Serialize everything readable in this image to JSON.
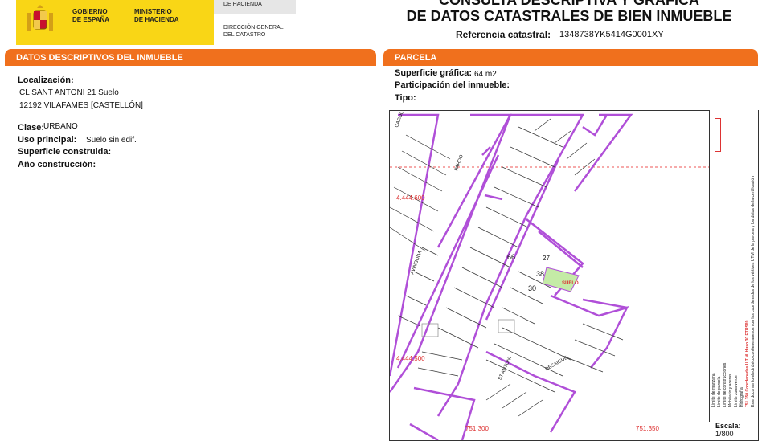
{
  "header": {
    "gobierno": [
      "GOBIERNO",
      "DE ESPAÑA"
    ],
    "ministerio": [
      "MINISTERIO",
      "DE HACIENDA"
    ],
    "hacienda_tab": "DE HACIENDA",
    "direccion": [
      "DIRECCIÓN GENERAL",
      "DEL CATASTRO"
    ],
    "title_top": "CONSULTA DESCRIPTIVA Y GRÁFICA",
    "title_main": "DE DATOS CATASTRALES DE BIEN INMUEBLE",
    "ref_label": "Referencia catastral:",
    "ref_value": "1348738YK5414G0001XY"
  },
  "left_section": {
    "title": "DATOS DESCRIPTIVOS DEL INMUEBLE",
    "localizacion_label": "Localización:",
    "address_line1": "CL SANT ANTONI 21 Suelo",
    "address_line2": "12192 VILAFAMES [CASTELLÓN]",
    "clase_label": "Clase:",
    "clase_value": "URBANO",
    "uso_label": "Uso principal:",
    "uso_value": "Suelo sin edif.",
    "superficie_label": "Superficie construida:",
    "anio_label": "Año construcción:"
  },
  "right_section": {
    "title": "PARCELA",
    "superficie_label": "Superficie gráfica:",
    "superficie_value": "64 m2",
    "participacion_label": "Participación del inmueble:",
    "tipo_label": "Tipo:"
  },
  "map": {
    "labels": {
      "coord_y1": "4.444.600",
      "coord_y2": "4.444.500",
      "coord_x1": "751.300",
      "coord_x2": "751.350",
      "parcel_66": "66",
      "parcel_38": "38",
      "parcel_30": "30",
      "parcel_27": "27",
      "suelo": "SUELO",
      "street_sant_antoni": "ST ANTONI",
      "street_desaigue": "DESAIGUE",
      "street_pardo": "PARDO",
      "street_carol": "CAROL",
      "street_avinguda": "AVINGUDA"
    },
    "legend": {
      "items": [
        "Límite de manzana",
        "Límite de parcela",
        "Límite de construcciones",
        "Mobiliario y aceras",
        "Límite zona verde",
        "Hidrografía"
      ],
      "note1": "751.350 Coordenadas U.T.M. Huso 30 ETRS89",
      "note2": "Este documento electrónico contiene anexos con las coordenadas de los vértices UTM de la parcela y los datos de la certificación"
    },
    "escala_label": "Escala:",
    "escala_value": "1/800"
  },
  "colors": {
    "accent_orange": "#f0701d",
    "gov_yellow": "#f9d616",
    "parcel_purple": "#b04fd8",
    "highlight_green": "#c4eba6"
  }
}
